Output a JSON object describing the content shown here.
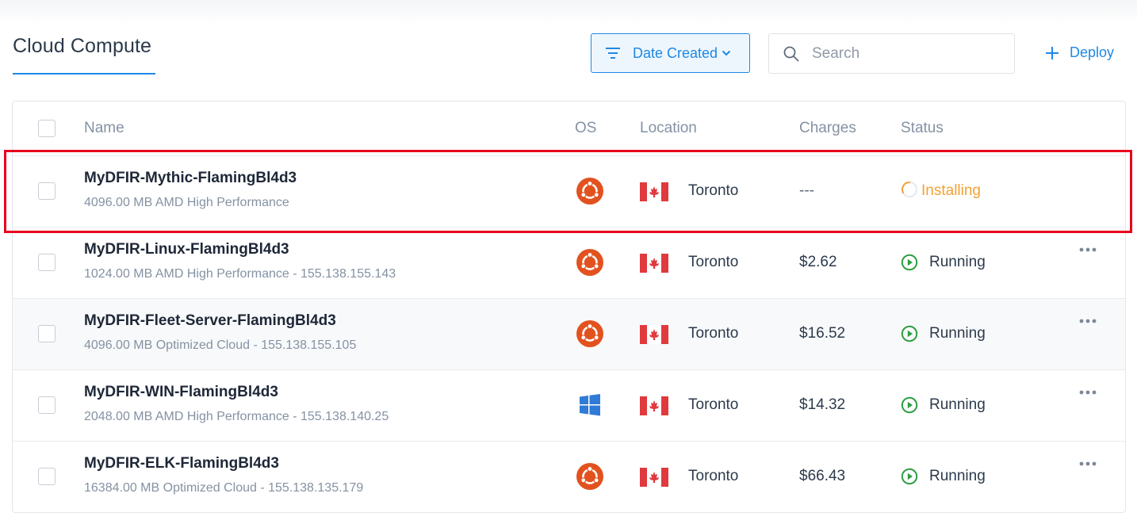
{
  "page": {
    "title": "Cloud Compute"
  },
  "toolbar": {
    "sort_label": "Date Created",
    "search_placeholder": "Search",
    "deploy_label": "Deploy"
  },
  "table": {
    "columns": {
      "name": "Name",
      "os": "OS",
      "location": "Location",
      "charges": "Charges",
      "status": "Status"
    },
    "rows": [
      {
        "name": "MyDFIR-Mythic-FlamingBl4d3",
        "spec": "4096.00 MB AMD High Performance",
        "os": "ubuntu-icon",
        "location": "Toronto",
        "flag": "canada-flag-icon",
        "charges": "---",
        "status": "Installing",
        "highlighted": true
      },
      {
        "name": "MyDFIR-Linux-FlamingBl4d3",
        "spec": "1024.00 MB AMD High Performance - 155.138.155.143",
        "os": "ubuntu-icon",
        "location": "Toronto",
        "flag": "canada-flag-icon",
        "charges": "$2.62",
        "status": "Running"
      },
      {
        "name": "MyDFIR-Fleet-Server-FlamingBl4d3",
        "spec": "4096.00 MB Optimized Cloud - 155.138.155.105",
        "os": "ubuntu-icon",
        "location": "Toronto",
        "flag": "canada-flag-icon",
        "charges": "$16.52",
        "status": "Running"
      },
      {
        "name": "MyDFIR-WIN-FlamingBl4d3",
        "spec": "2048.00 MB AMD High Performance - 155.138.140.25",
        "os": "windows-icon",
        "location": "Toronto",
        "flag": "canada-flag-icon",
        "charges": "$14.32",
        "status": "Running"
      },
      {
        "name": "MyDFIR-ELK-FlamingBl4d3",
        "spec": "16384.00 MB Optimized Cloud - 155.138.135.179",
        "os": "ubuntu-icon",
        "location": "Toronto",
        "flag": "canada-flag-icon",
        "charges": "$66.43",
        "status": "Running"
      }
    ]
  },
  "colors": {
    "accent": "#1e88e5",
    "installing": "#f5a033",
    "running": "#2e9e44",
    "ubuntu": "#e2521f",
    "windows": "#2f7bd6",
    "highlight": "#e8001c"
  }
}
